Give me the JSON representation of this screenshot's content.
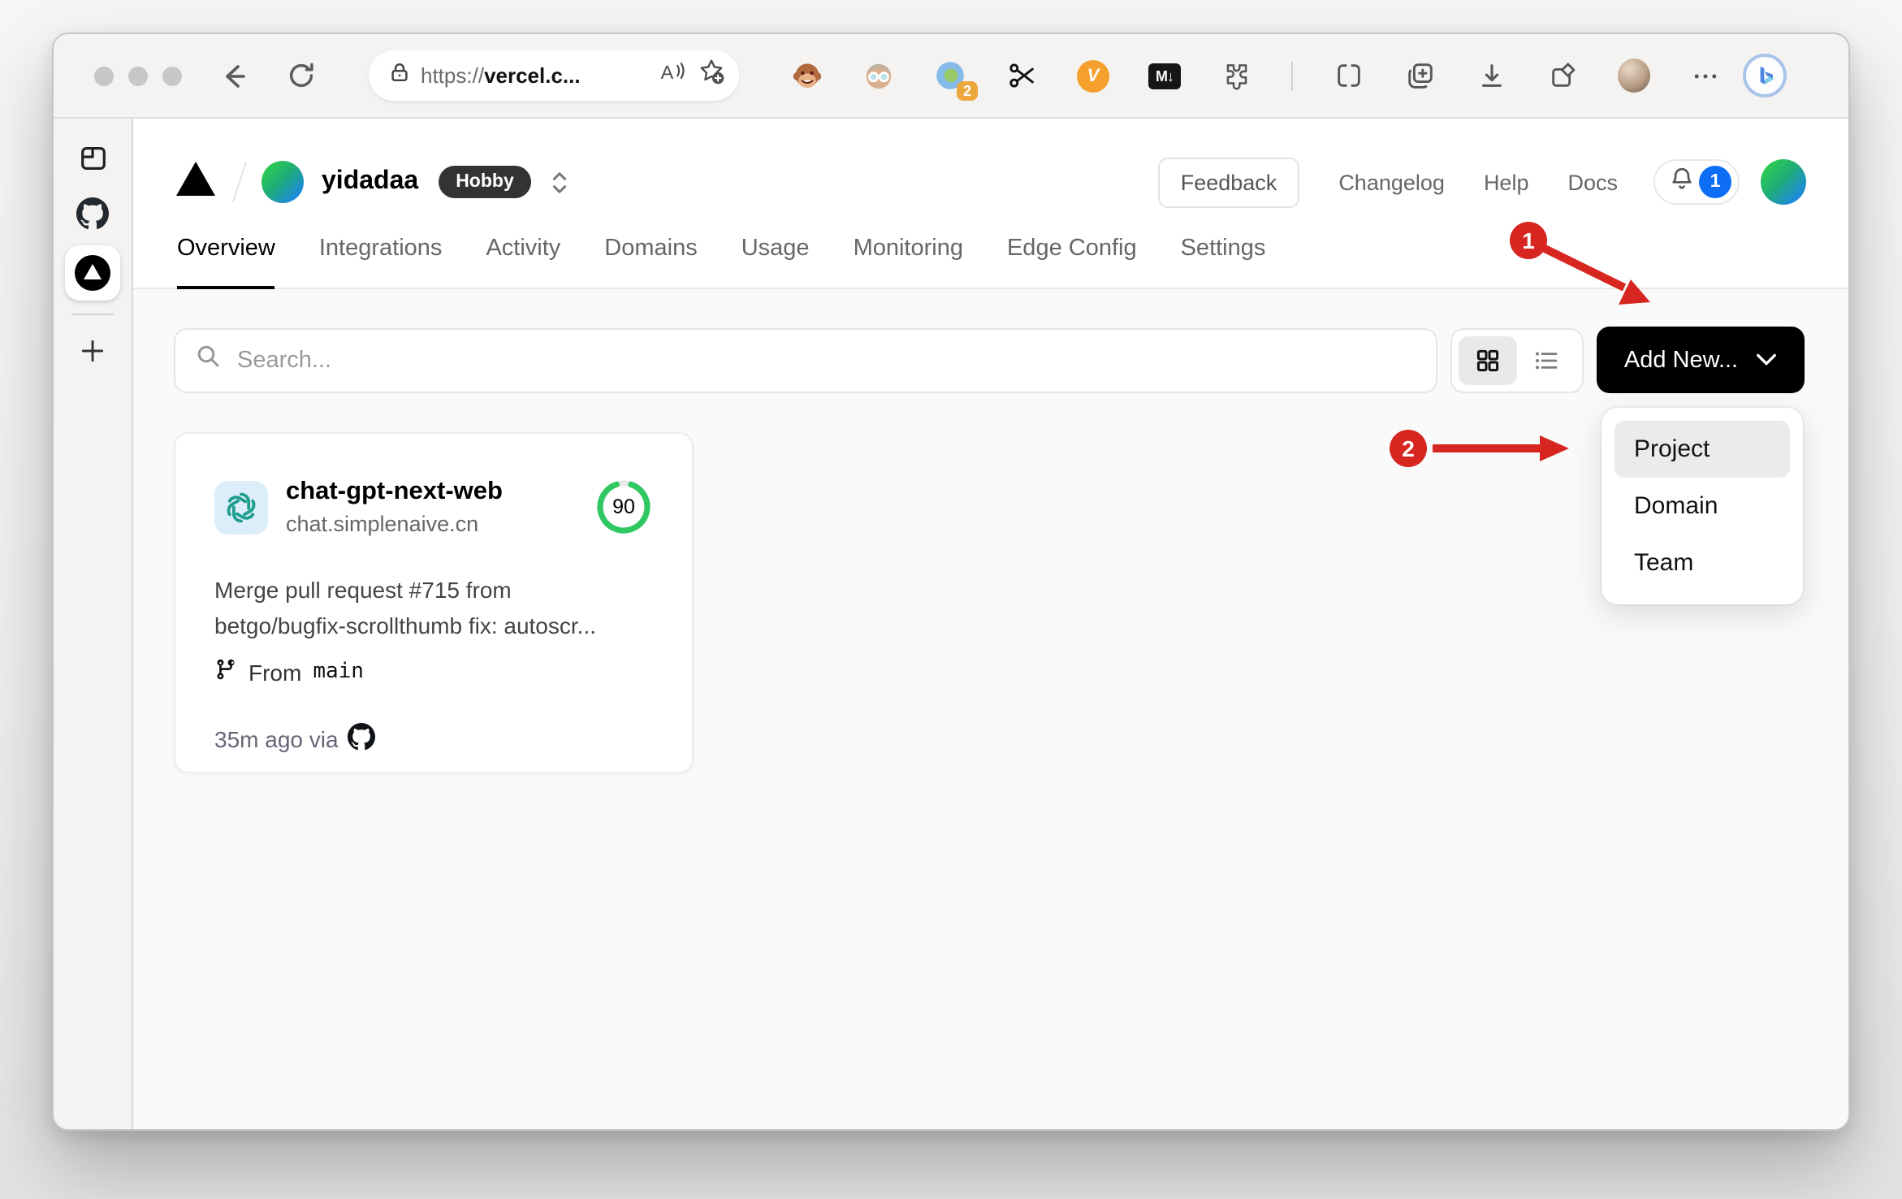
{
  "browser": {
    "url_scheme": "https://",
    "url_host": "vercel.c...",
    "extension_badge_count": "2",
    "markdown_extension_label": "M↓",
    "v_extension_label": "V"
  },
  "sidebar": {
    "tabs": [
      "github-tab",
      "vercel-tab-active"
    ]
  },
  "header": {
    "team_name": "yidadaa",
    "plan_badge": "Hobby",
    "feedback_label": "Feedback",
    "links": [
      {
        "label": "Changelog"
      },
      {
        "label": "Help"
      },
      {
        "label": "Docs"
      }
    ],
    "notification_count": "1"
  },
  "tabs": {
    "items": [
      {
        "label": "Overview",
        "active": true
      },
      {
        "label": "Integrations"
      },
      {
        "label": "Activity"
      },
      {
        "label": "Domains"
      },
      {
        "label": "Usage"
      },
      {
        "label": "Monitoring"
      },
      {
        "label": "Edge Config"
      },
      {
        "label": "Settings"
      }
    ]
  },
  "controls": {
    "search_placeholder": "Search...",
    "add_new_label": "Add New..."
  },
  "add_new_menu": {
    "items": [
      {
        "label": "Project",
        "highlighted": true
      },
      {
        "label": "Domain"
      },
      {
        "label": "Team"
      }
    ]
  },
  "project_card": {
    "name": "chat-gpt-next-web",
    "domain": "chat.simplenaive.cn",
    "score": "90",
    "commit_line1": "Merge pull request #715 from",
    "commit_line2": "betgo/bugfix-scrollthumb fix: autoscr...",
    "branch_label": "From",
    "branch_name": "main",
    "deployed_text": "35m ago via"
  },
  "annotations": {
    "step1": "1",
    "step2": "2"
  },
  "colors": {
    "accent_blue": "#0d6ef5",
    "success_green": "#2fc863",
    "annotation_red": "#d7261f",
    "add_new_button": "#000000",
    "plan_badge_bg": "#333333",
    "openai_icon": "#1f9e8e",
    "openai_icon_bg": "#ddeefb"
  }
}
